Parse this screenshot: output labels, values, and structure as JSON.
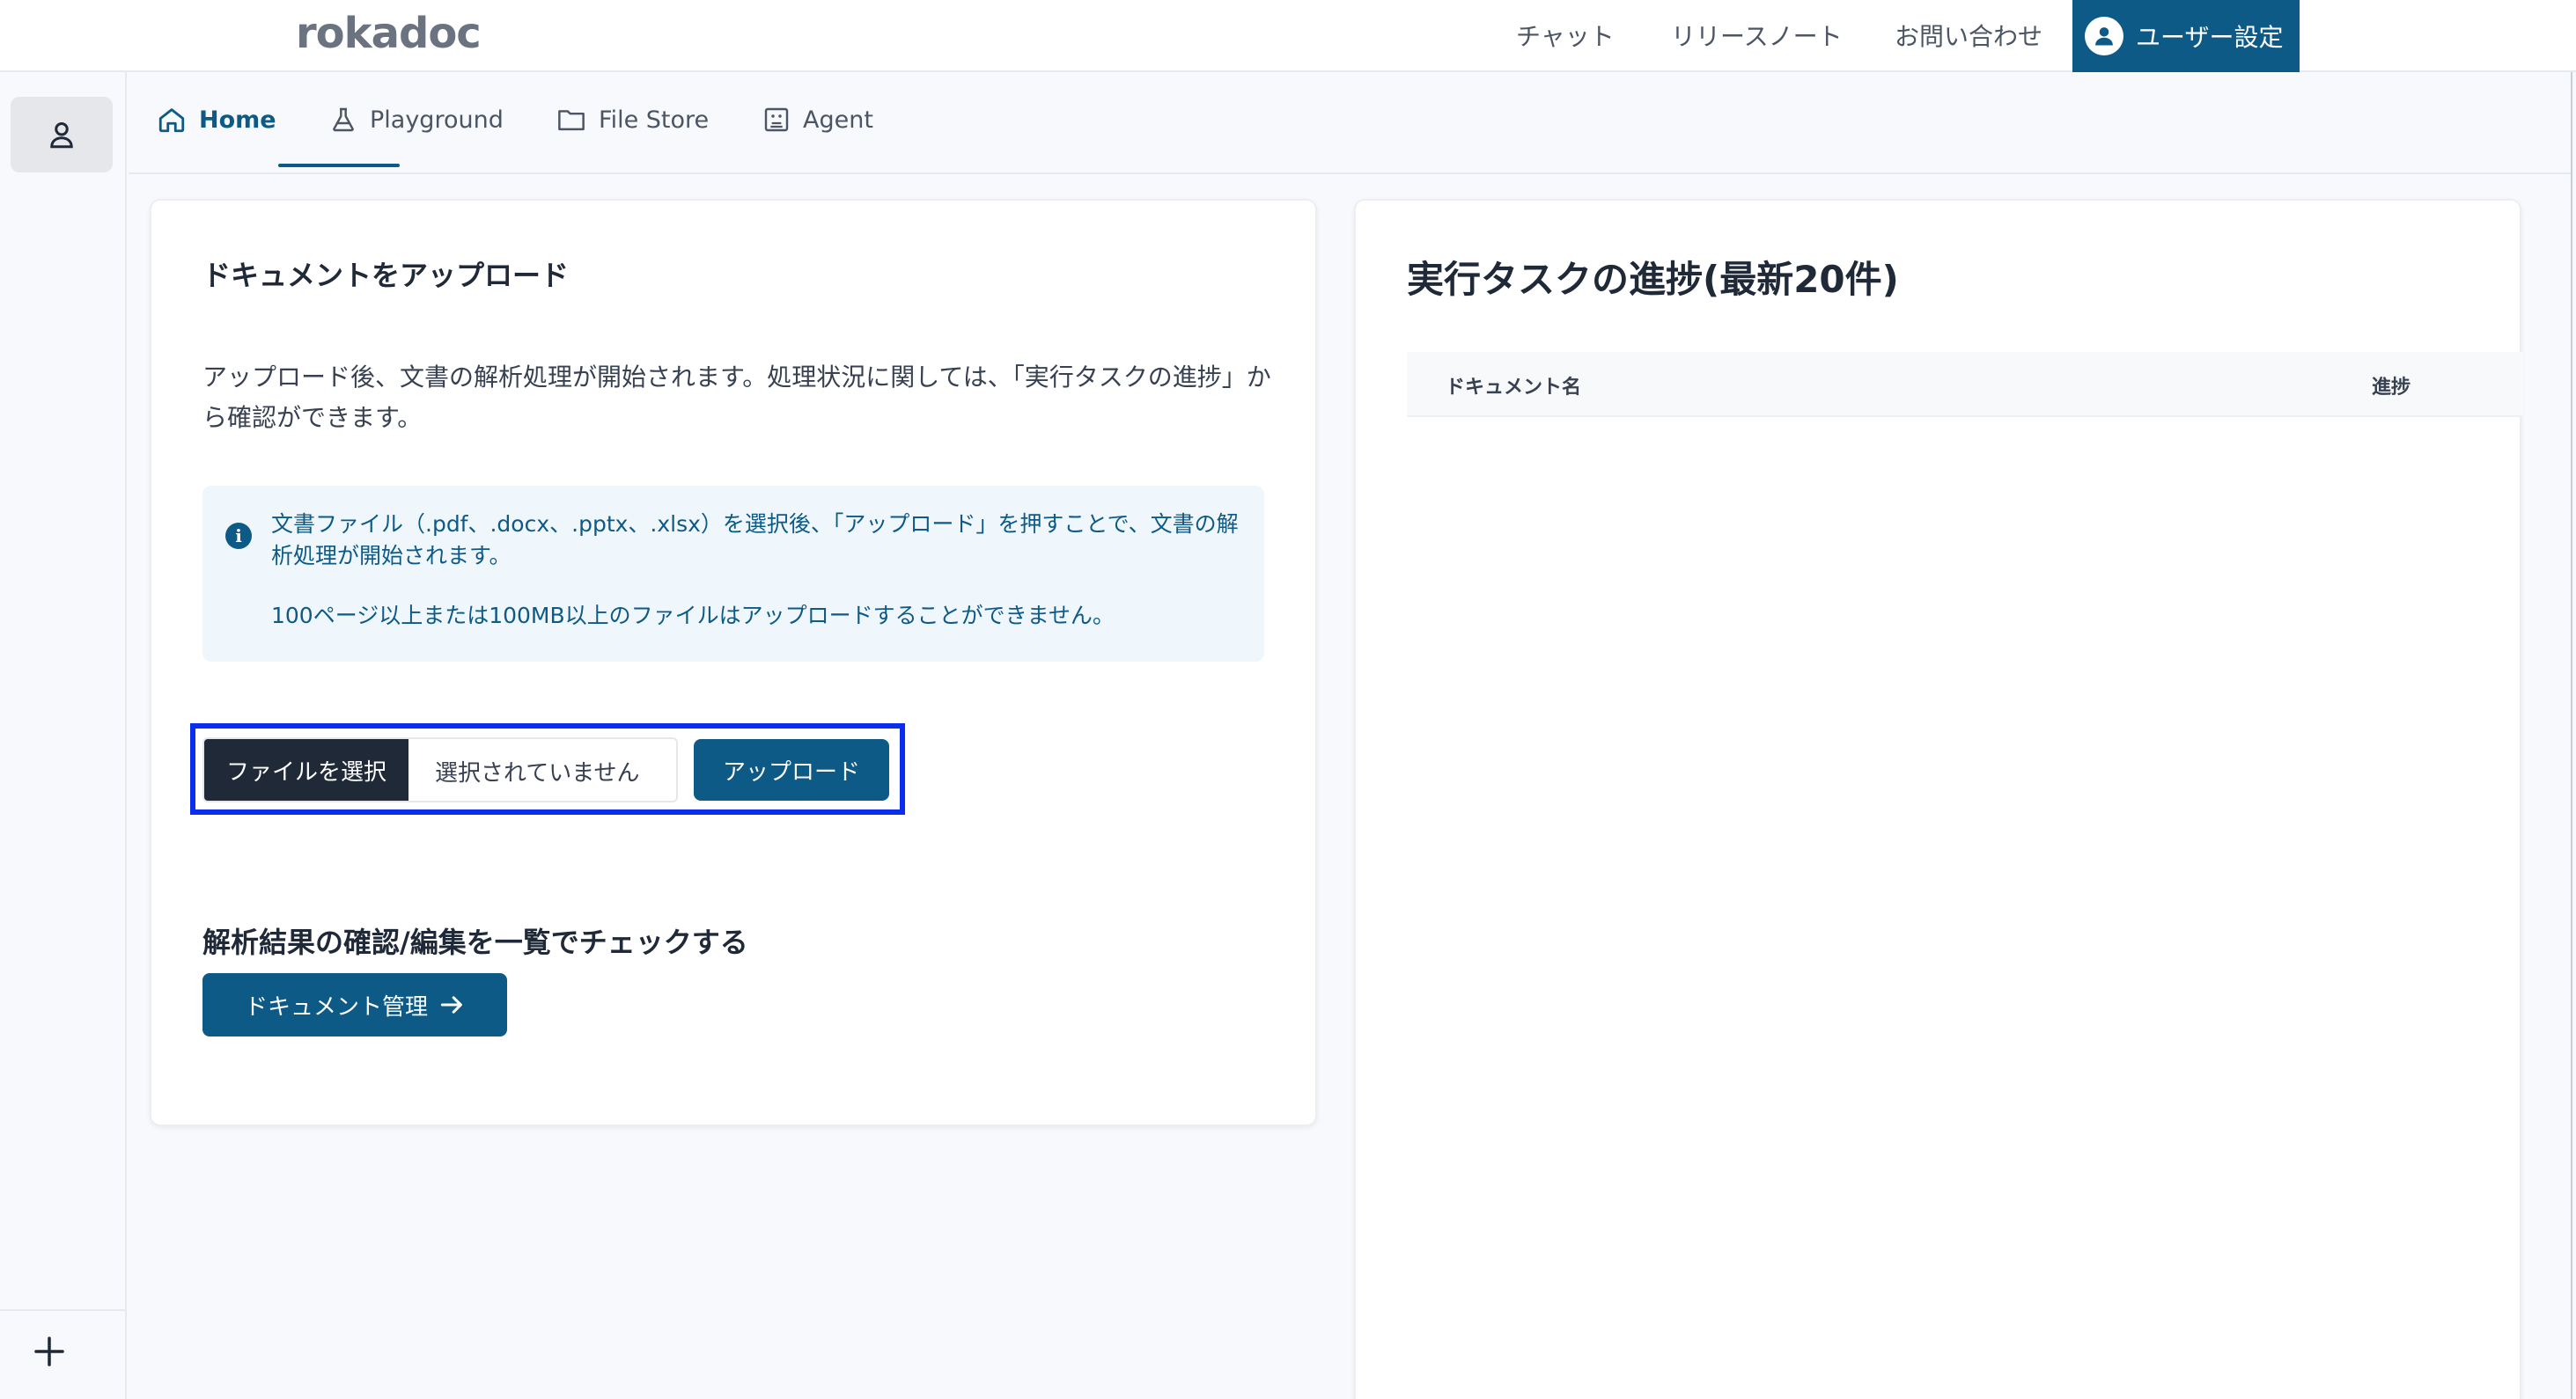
{
  "app": {
    "brand": "rokadoc"
  },
  "topnav": {
    "items": [
      "チャット",
      "リリースノート",
      "お問い合わせ"
    ],
    "user_settings": "ユーザー設定"
  },
  "tabs": [
    {
      "label": "Home",
      "icon": "home-icon",
      "active": true
    },
    {
      "label": "Playground",
      "icon": "flask-icon",
      "active": false
    },
    {
      "label": "File Store",
      "icon": "folder-icon",
      "active": false
    },
    {
      "label": "Agent",
      "icon": "agent-icon",
      "active": false
    }
  ],
  "upload": {
    "title": "ドキュメントをアップロード",
    "description": "アップロード後、文書の解析処理が開始されます。処理状況に関しては、「実行タスクの進捗」から確認ができます。",
    "info_line1": "文書ファイル（.pdf、.docx、.pptx、.xlsx）を選択後、「アップロード」を押すことで、文書の解析処理が開始されます。",
    "info_line2": "100ページ以上または100MB以上のファイルはアップロードすることができません。",
    "choose_file_label": "ファイルを選択",
    "no_file_text": "選択されていません",
    "upload_button": "アップロード"
  },
  "analysis": {
    "title": "解析結果の確認/編集を一覧でチェックする",
    "button": "ドキュメント管理"
  },
  "progress": {
    "title": "実行タスクの進捗(最新20件)",
    "columns": [
      "ドキュメント名",
      "進捗"
    ]
  },
  "colors": {
    "accent": "#0d5a86",
    "highlight_frame": "#0a2df0",
    "dark_button": "#1f2937"
  }
}
